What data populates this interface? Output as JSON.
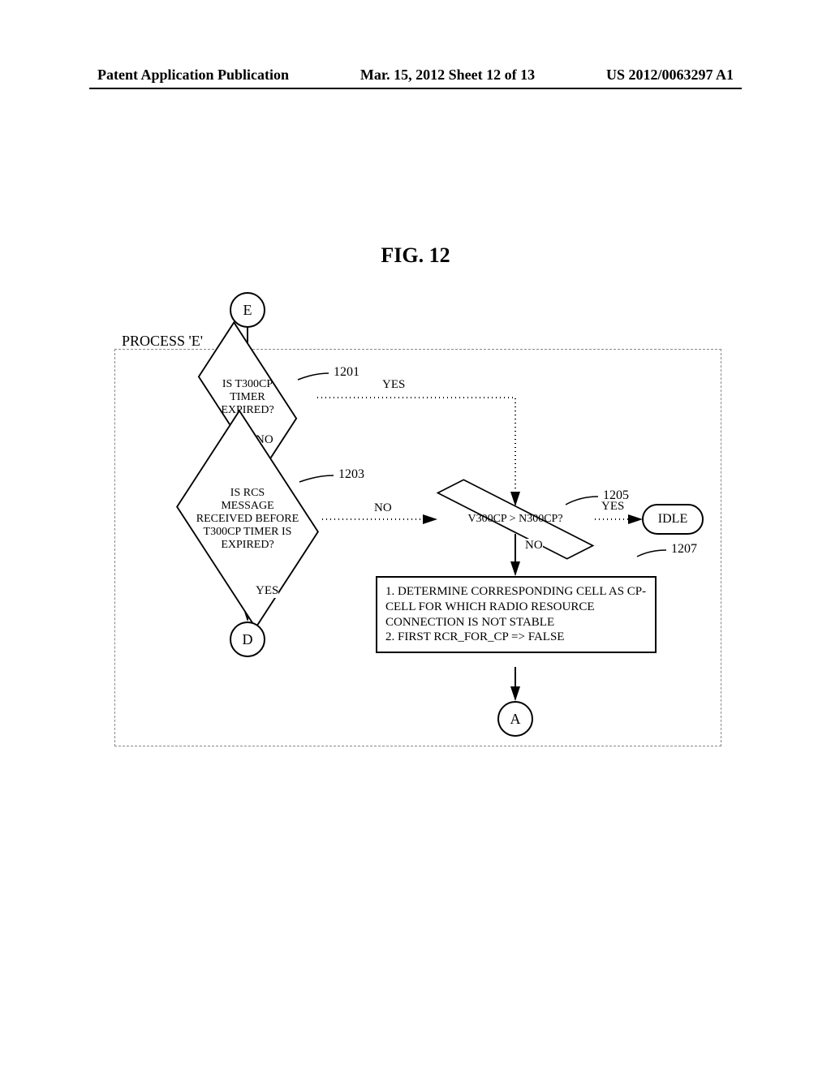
{
  "header": {
    "left": "Patent Application Publication",
    "center": "Mar. 15, 2012  Sheet 12 of 13",
    "right": "US 2012/0063297 A1"
  },
  "figure_title": "FIG. 12",
  "process_label": "PROCESS 'E'",
  "connectors": {
    "E": "E",
    "D": "D",
    "A": "A"
  },
  "decisions": {
    "d1201": "IS T300CP\nTIMER\nEXPIRED?",
    "d1203": "IS RCS\nMESSAGE\nRECEIVED BEFORE\nT300CP TIMER IS\nEXPIRED?",
    "d1205": "V300CP > N300CP?"
  },
  "process_1207": "1. DETERMINE CORRESPONDING CELL AS CP-CELL FOR WHICH RADIO RESOURCE CONNECTION IS NOT STABLE\n2. FIRST RCR_FOR_CP => FALSE",
  "terminator_idle": "IDLE",
  "edge_labels": {
    "yes": "YES",
    "no": "NO"
  },
  "refs": {
    "r1201": "1201",
    "r1203": "1203",
    "r1205": "1205",
    "r1207": "1207"
  },
  "chart_data": {
    "type": "flowchart",
    "title": "FIG. 12",
    "group_label": "PROCESS 'E'",
    "nodes": [
      {
        "id": "E",
        "type": "connector",
        "label": "E"
      },
      {
        "id": "1201",
        "type": "decision",
        "label": "IS T300CP TIMER EXPIRED?",
        "ref": "1201"
      },
      {
        "id": "1203",
        "type": "decision",
        "label": "IS RCS MESSAGE RECEIVED BEFORE T300CP TIMER IS EXPIRED?",
        "ref": "1203"
      },
      {
        "id": "1205",
        "type": "decision",
        "label": "V300CP > N300CP?",
        "ref": "1205"
      },
      {
        "id": "1207",
        "type": "process",
        "label": "1. DETERMINE CORRESPONDING CELL AS CP-CELL FOR WHICH RADIO RESOURCE CONNECTION IS NOT STABLE 2. FIRST RCR_FOR_CP => FALSE",
        "ref": "1207"
      },
      {
        "id": "IDLE",
        "type": "terminator",
        "label": "IDLE"
      },
      {
        "id": "D",
        "type": "connector",
        "label": "D"
      },
      {
        "id": "A",
        "type": "connector",
        "label": "A"
      }
    ],
    "edges": [
      {
        "from": "E",
        "to": "1201"
      },
      {
        "from": "1201",
        "to": "1205",
        "label": "YES"
      },
      {
        "from": "1201",
        "to": "1203",
        "label": "NO"
      },
      {
        "from": "1203",
        "to": "1205",
        "label": "NO"
      },
      {
        "from": "1203",
        "to": "D",
        "label": "YES"
      },
      {
        "from": "1205",
        "to": "IDLE",
        "label": "YES"
      },
      {
        "from": "1205",
        "to": "1207",
        "label": "NO"
      },
      {
        "from": "1207",
        "to": "A"
      }
    ]
  }
}
